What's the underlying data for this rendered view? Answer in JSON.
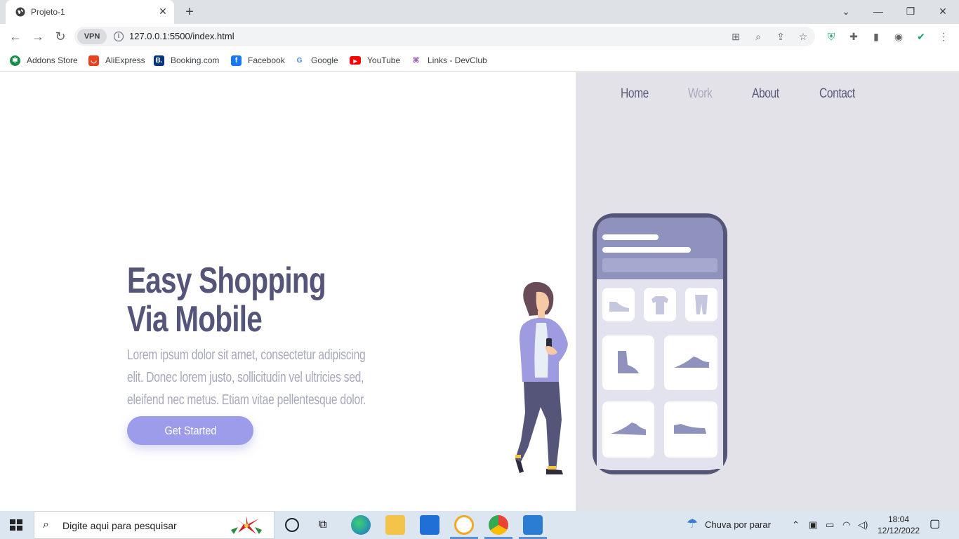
{
  "browser": {
    "tab_title": "Projeto-1",
    "tab_close": "✕",
    "new_tab": "+",
    "url": "127.0.0.1:5500/index.html",
    "vpn_label": "VPN",
    "window_controls": [
      "chevron-down",
      "minimize",
      "restore",
      "close"
    ]
  },
  "bookmarks": [
    {
      "label": "Addons Store",
      "icon": "addons-icon",
      "color": "#1a8a4a"
    },
    {
      "label": "AliExpress",
      "icon": "aliexpress-icon",
      "color": "#e8411f"
    },
    {
      "label": "Booking.com",
      "icon": "booking-icon",
      "color": "#003580"
    },
    {
      "label": "Facebook",
      "icon": "facebook-icon",
      "color": "#1877f2"
    },
    {
      "label": "Google",
      "icon": "google-icon",
      "color": "#4285f4"
    },
    {
      "label": "YouTube",
      "icon": "youtube-icon",
      "color": "#ff0000"
    },
    {
      "label": "Links - DevClub",
      "icon": "devclub-icon",
      "color": "#9b59b6"
    }
  ],
  "nav": {
    "home": "Home",
    "work": "Work",
    "about": "About",
    "contact": "Contact"
  },
  "hero": {
    "title_line1": "Easy Shopping",
    "title_line2": "Via Mobile",
    "description": "Lorem ipsum dolor sit amet, consectetur adipiscing elit. Donec lorem justo, sollicitudin vel ultricies sed, eleifend nec metus. Etiam vitae pellentesque dolor.",
    "cta_label": "Get Started"
  },
  "colors": {
    "accent": "#9c9ceb",
    "title": "#55557a",
    "panel": "#e3e2e8",
    "phone": "#55557a"
  },
  "taskbar": {
    "search_placeholder": "Digite aqui para pesquisar",
    "weather": "Chuva por parar",
    "time": "18:04",
    "date": "12/12/2022"
  }
}
